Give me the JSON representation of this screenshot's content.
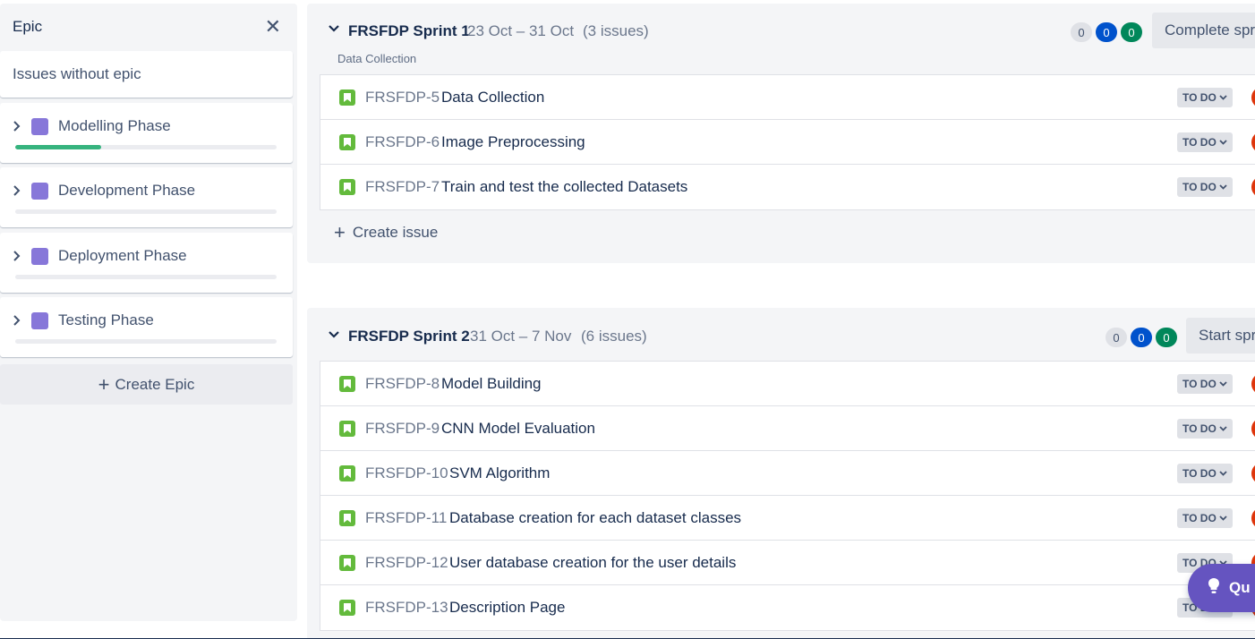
{
  "epic_panel": {
    "title": "Epic",
    "issues_without_epic": "Issues without epic",
    "epics": [
      {
        "name": "Modelling Phase",
        "progress": 0.33
      },
      {
        "name": "Development Phase",
        "progress": 0
      },
      {
        "name": "Deployment Phase",
        "progress": 0
      },
      {
        "name": "Testing Phase",
        "progress": 0
      }
    ],
    "create_epic": "Create Epic"
  },
  "sprint1": {
    "name": "FRSFDP Sprint 1",
    "dates": "23 Oct – 31 Oct",
    "count": "(3 issues)",
    "subtitle": "Data Collection",
    "counts": {
      "todo": "0",
      "in_progress": "0",
      "done": "0"
    },
    "button": "Complete sprint",
    "issues": [
      {
        "key": "FRSFDP-5",
        "summary": "Data Collection",
        "status": "TO DO"
      },
      {
        "key": "FRSFDP-6",
        "summary": "Image Preprocessing",
        "status": "TO DO"
      },
      {
        "key": "FRSFDP-7",
        "summary": "Train and test the collected Datasets",
        "status": "TO DO"
      }
    ],
    "create_issue": "Create issue"
  },
  "sprint2": {
    "name": "FRSFDP Sprint 2",
    "dates": "31 Oct – 7 Nov",
    "count": "(6 issues)",
    "counts": {
      "todo": "0",
      "in_progress": "0",
      "done": "0"
    },
    "button": "Start sprint",
    "issues": [
      {
        "key": "FRSFDP-8",
        "summary": "Model Building",
        "status": "TO DO"
      },
      {
        "key": "FRSFDP-9",
        "summary": "CNN Model Evaluation",
        "status": "TO DO"
      },
      {
        "key": "FRSFDP-10",
        "summary": "SVM Algorithm",
        "status": "TO DO"
      },
      {
        "key": "FRSFDP-11",
        "summary": "Database creation for each dataset classes",
        "status": "TO DO"
      },
      {
        "key": "FRSFDP-12",
        "summary": "User database creation for the user details",
        "status": "TO DO"
      },
      {
        "key": "FRSFDP-13",
        "summary": "Description Page",
        "status": "TO DO"
      }
    ]
  },
  "help_fab": {
    "label": "Qu"
  },
  "colors": {
    "epic": "#8777d9",
    "story": "#63ba3c",
    "progress": "#36b37e",
    "fab": "#6554c0"
  }
}
